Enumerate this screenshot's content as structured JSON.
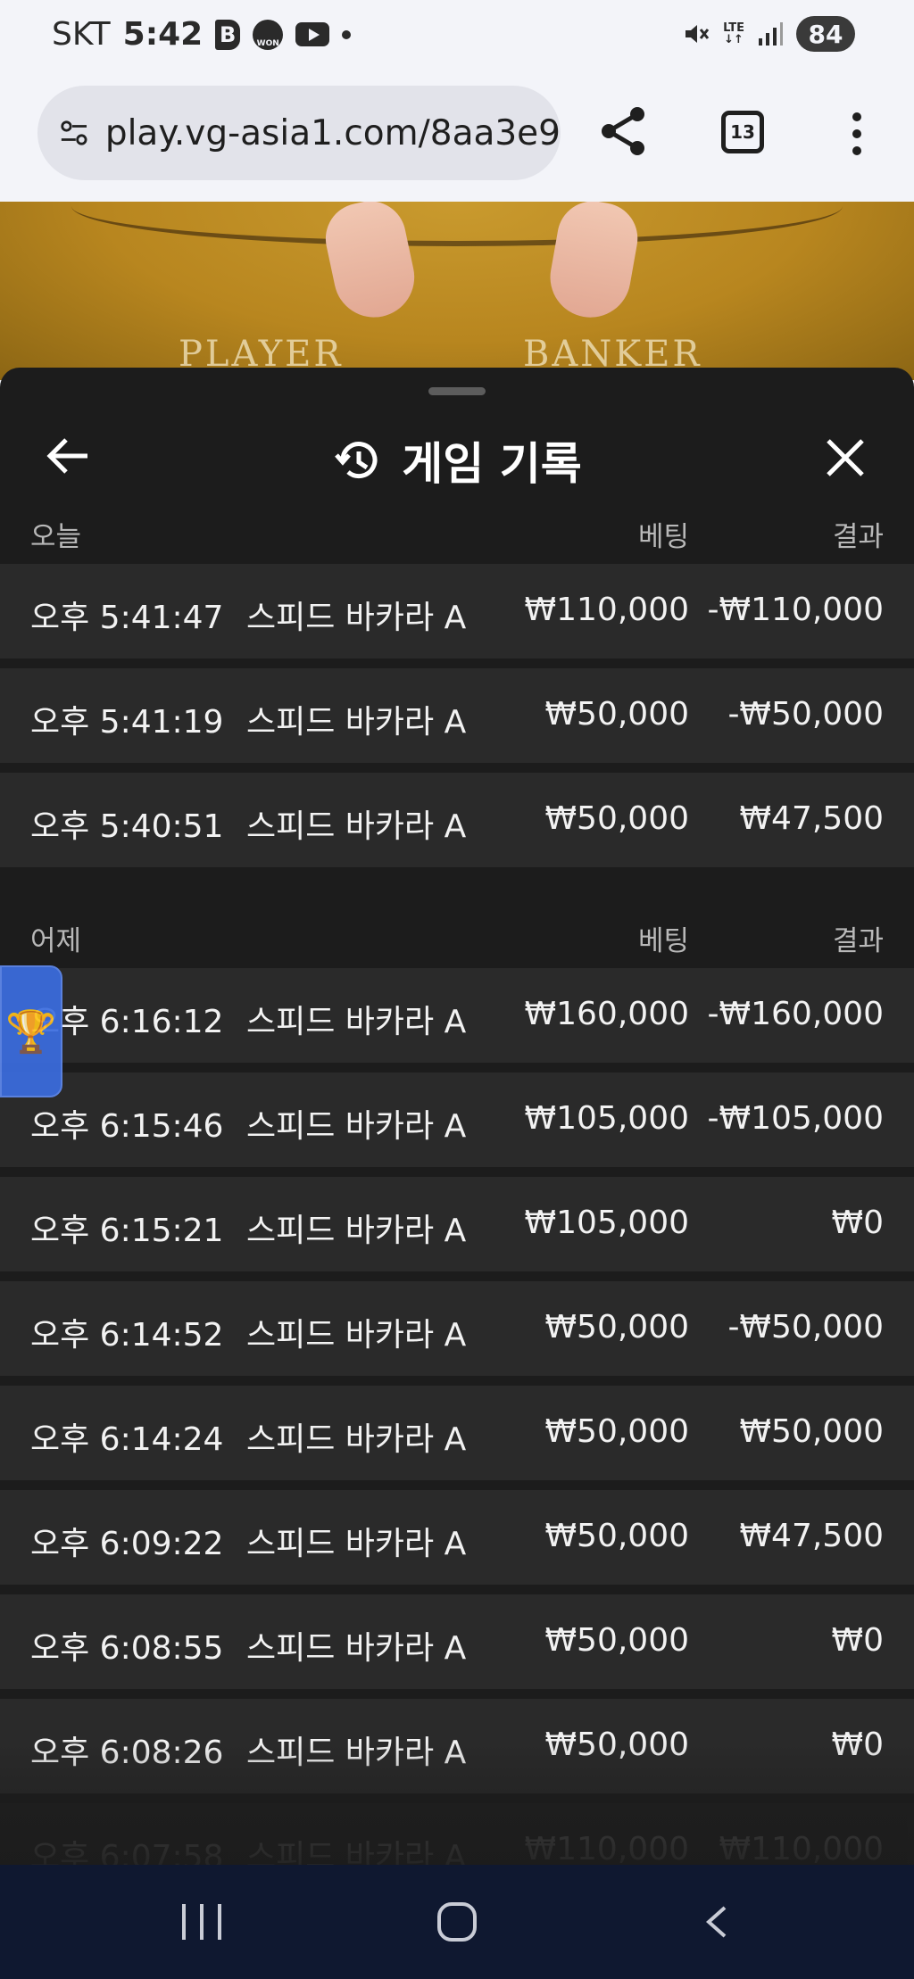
{
  "status_bar": {
    "carrier": "SKT",
    "time": "5:42",
    "app_b": "B",
    "app_won": "WON",
    "network": "LTE",
    "battery": "84"
  },
  "browser": {
    "url": "play.vg-asia1.com/8aa3e9",
    "tab_count": "13"
  },
  "game_table": {
    "player_label": "PLAYER",
    "banker_label": "BANKER"
  },
  "panel": {
    "title": "게임 기록"
  },
  "today": {
    "label": "오늘",
    "bet_header": "베팅",
    "result_header": "결과",
    "rows": [
      {
        "time": "오후 5:41:47",
        "game": "스피드 바카라 A",
        "bet": "₩110,000",
        "result": "-₩110,000"
      },
      {
        "time": "오후 5:41:19",
        "game": "스피드 바카라 A",
        "bet": "₩50,000",
        "result": "-₩50,000"
      },
      {
        "time": "오후 5:40:51",
        "game": "스피드 바카라 A",
        "bet": "₩50,000",
        "result": "₩47,500"
      }
    ]
  },
  "yesterday": {
    "label": "어제",
    "bet_header": "베팅",
    "result_header": "결과",
    "rows": [
      {
        "time": "오후 6:16:12",
        "game": "스피드 바카라 A",
        "bet": "₩160,000",
        "result": "-₩160,000"
      },
      {
        "time": "오후 6:15:46",
        "game": "스피드 바카라 A",
        "bet": "₩105,000",
        "result": "-₩105,000"
      },
      {
        "time": "오후 6:15:21",
        "game": "스피드 바카라 A",
        "bet": "₩105,000",
        "result": "₩0"
      },
      {
        "time": "오후 6:14:52",
        "game": "스피드 바카라 A",
        "bet": "₩50,000",
        "result": "-₩50,000"
      },
      {
        "time": "오후 6:14:24",
        "game": "스피드 바카라 A",
        "bet": "₩50,000",
        "result": "₩50,000"
      },
      {
        "time": "오후 6:09:22",
        "game": "스피드 바카라 A",
        "bet": "₩50,000",
        "result": "₩47,500"
      },
      {
        "time": "오후 6:08:55",
        "game": "스피드 바카라 A",
        "bet": "₩50,000",
        "result": "₩0"
      },
      {
        "time": "오후 6:08:26",
        "game": "스피드 바카라 A",
        "bet": "₩50,000",
        "result": "₩0"
      },
      {
        "time": "오후 6:07:58",
        "game": "스피드 바카라 A",
        "bet": "₩110,000",
        "result": "₩110,000"
      }
    ]
  },
  "floating": {
    "icon": "trophy-icon",
    "glyph": "🏆"
  }
}
